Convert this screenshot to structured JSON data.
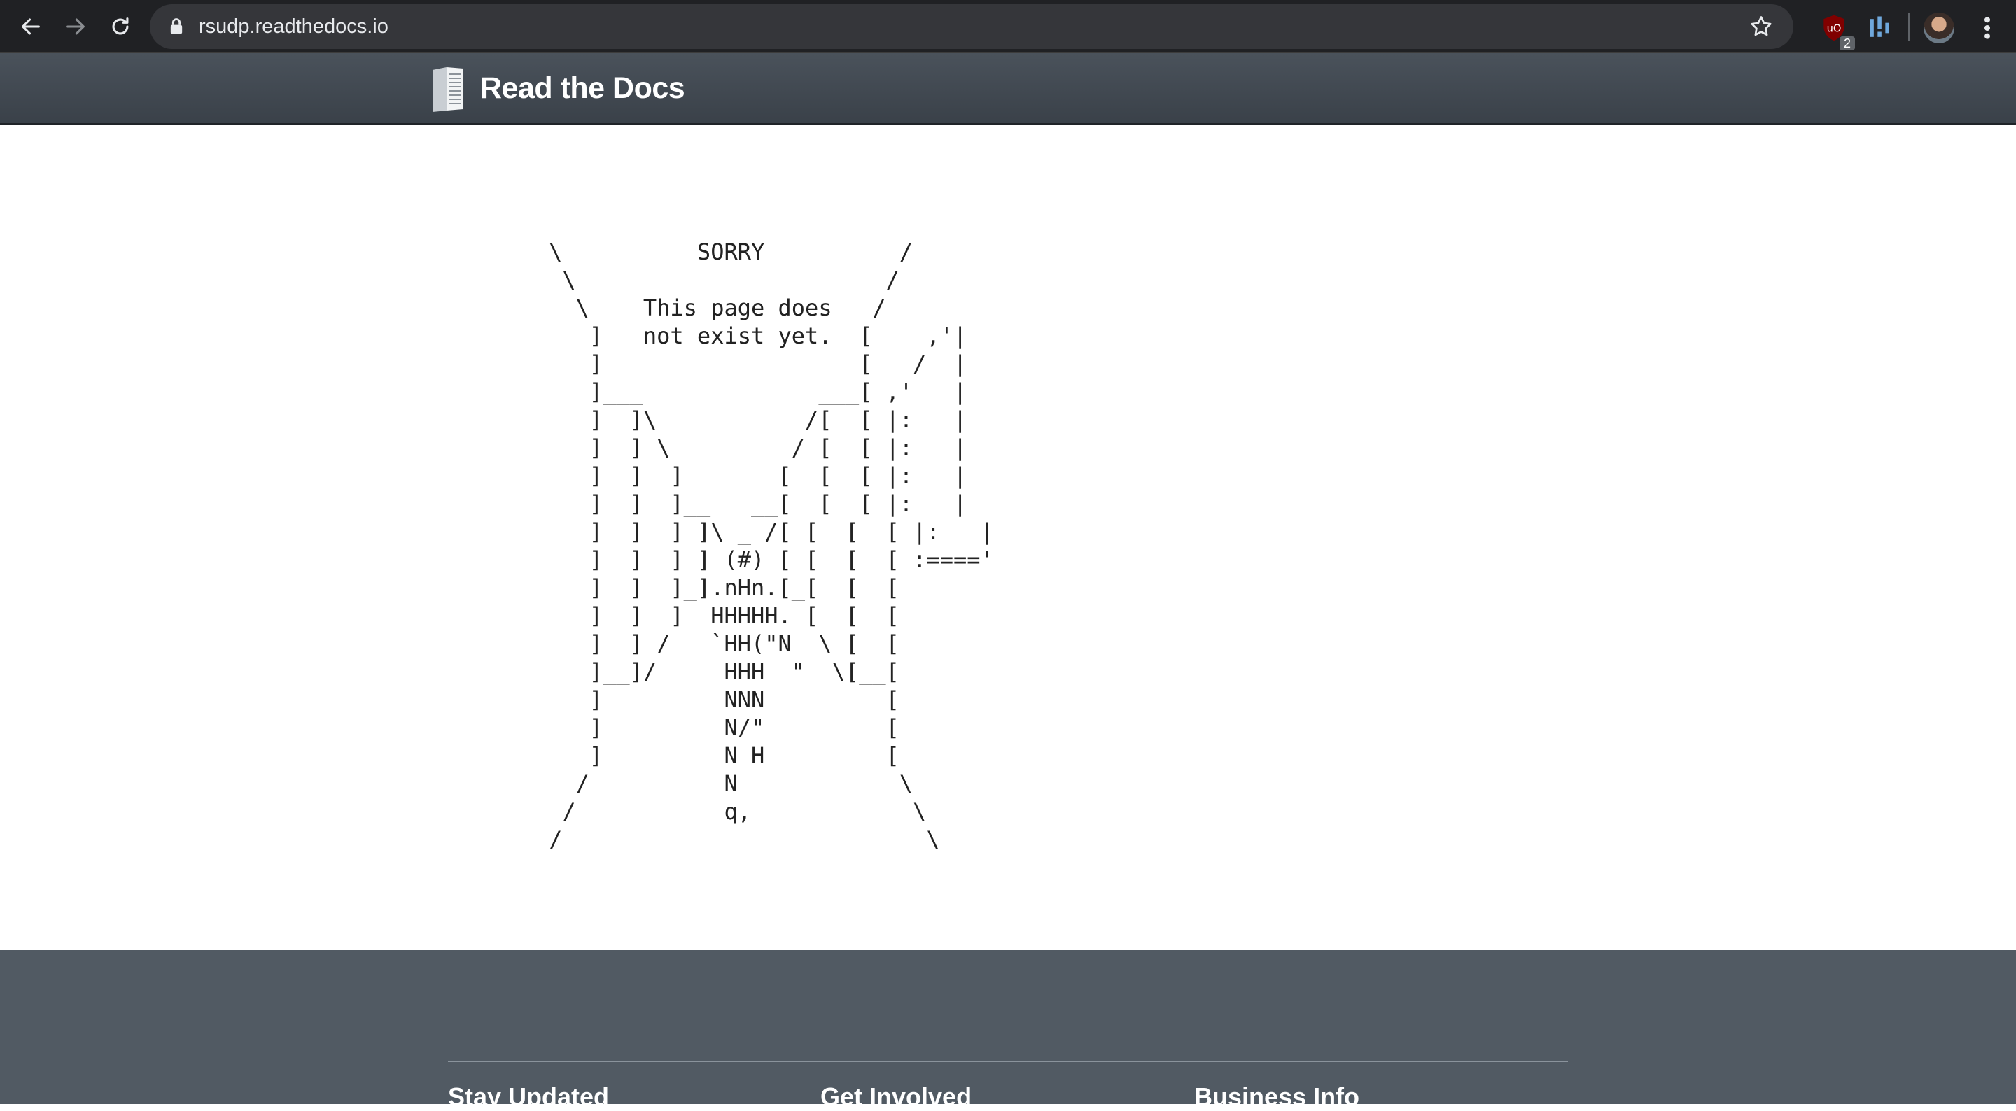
{
  "browser": {
    "url": "rsudp.readthedocs.io",
    "extensions": [
      {
        "icon": "ublock-origin-icon",
        "badge": "2"
      },
      {
        "icon": "pinpoint-extension-icon"
      }
    ]
  },
  "header": {
    "brand": "Read the Docs",
    "logo_icon": "book-logo-icon"
  },
  "main": {
    "ascii_art": "\\          SORRY          /\n \\                       /\n  \\    This page does   /\n   ]   not exist yet.  [    ,'|\n   ]                   [   /  |\n   ]___             ___[ ,'   |\n   ]  ]\\           /[  [ |:   |\n   ]  ] \\         / [  [ |:   |\n   ]  ]  ]       [  [  [ |:   |\n   ]  ]  ]__   __[  [  [ |:   |\n   ]  ]  ] ]\\ _ /[ [  [  [ |:   |\n   ]  ]  ] ] (#) [ [  [  [ :===='\n   ]  ]  ]_].nHn.[_[  [  [\n   ]  ]  ]  HHHHH. [  [  [\n   ]  ] /   `HH(\"N  \\ [  [\n   ]__]/     HHH  \"  \\[__[\n   ]         NNN         [\n   ]         N/\"         [\n   ]         N H         [\n  /          N            \\\n /           q,            \\\n/                           \\"
  },
  "footer": {
    "columns": [
      {
        "title": "Stay Updated"
      },
      {
        "title": "Get Involved"
      },
      {
        "title": "Business Info"
      }
    ]
  },
  "colors": {
    "chrome_bg": "#202124",
    "omnibox_bg": "#35363a",
    "header_bg": "#3f464e",
    "footer_bg": "#515a63"
  }
}
